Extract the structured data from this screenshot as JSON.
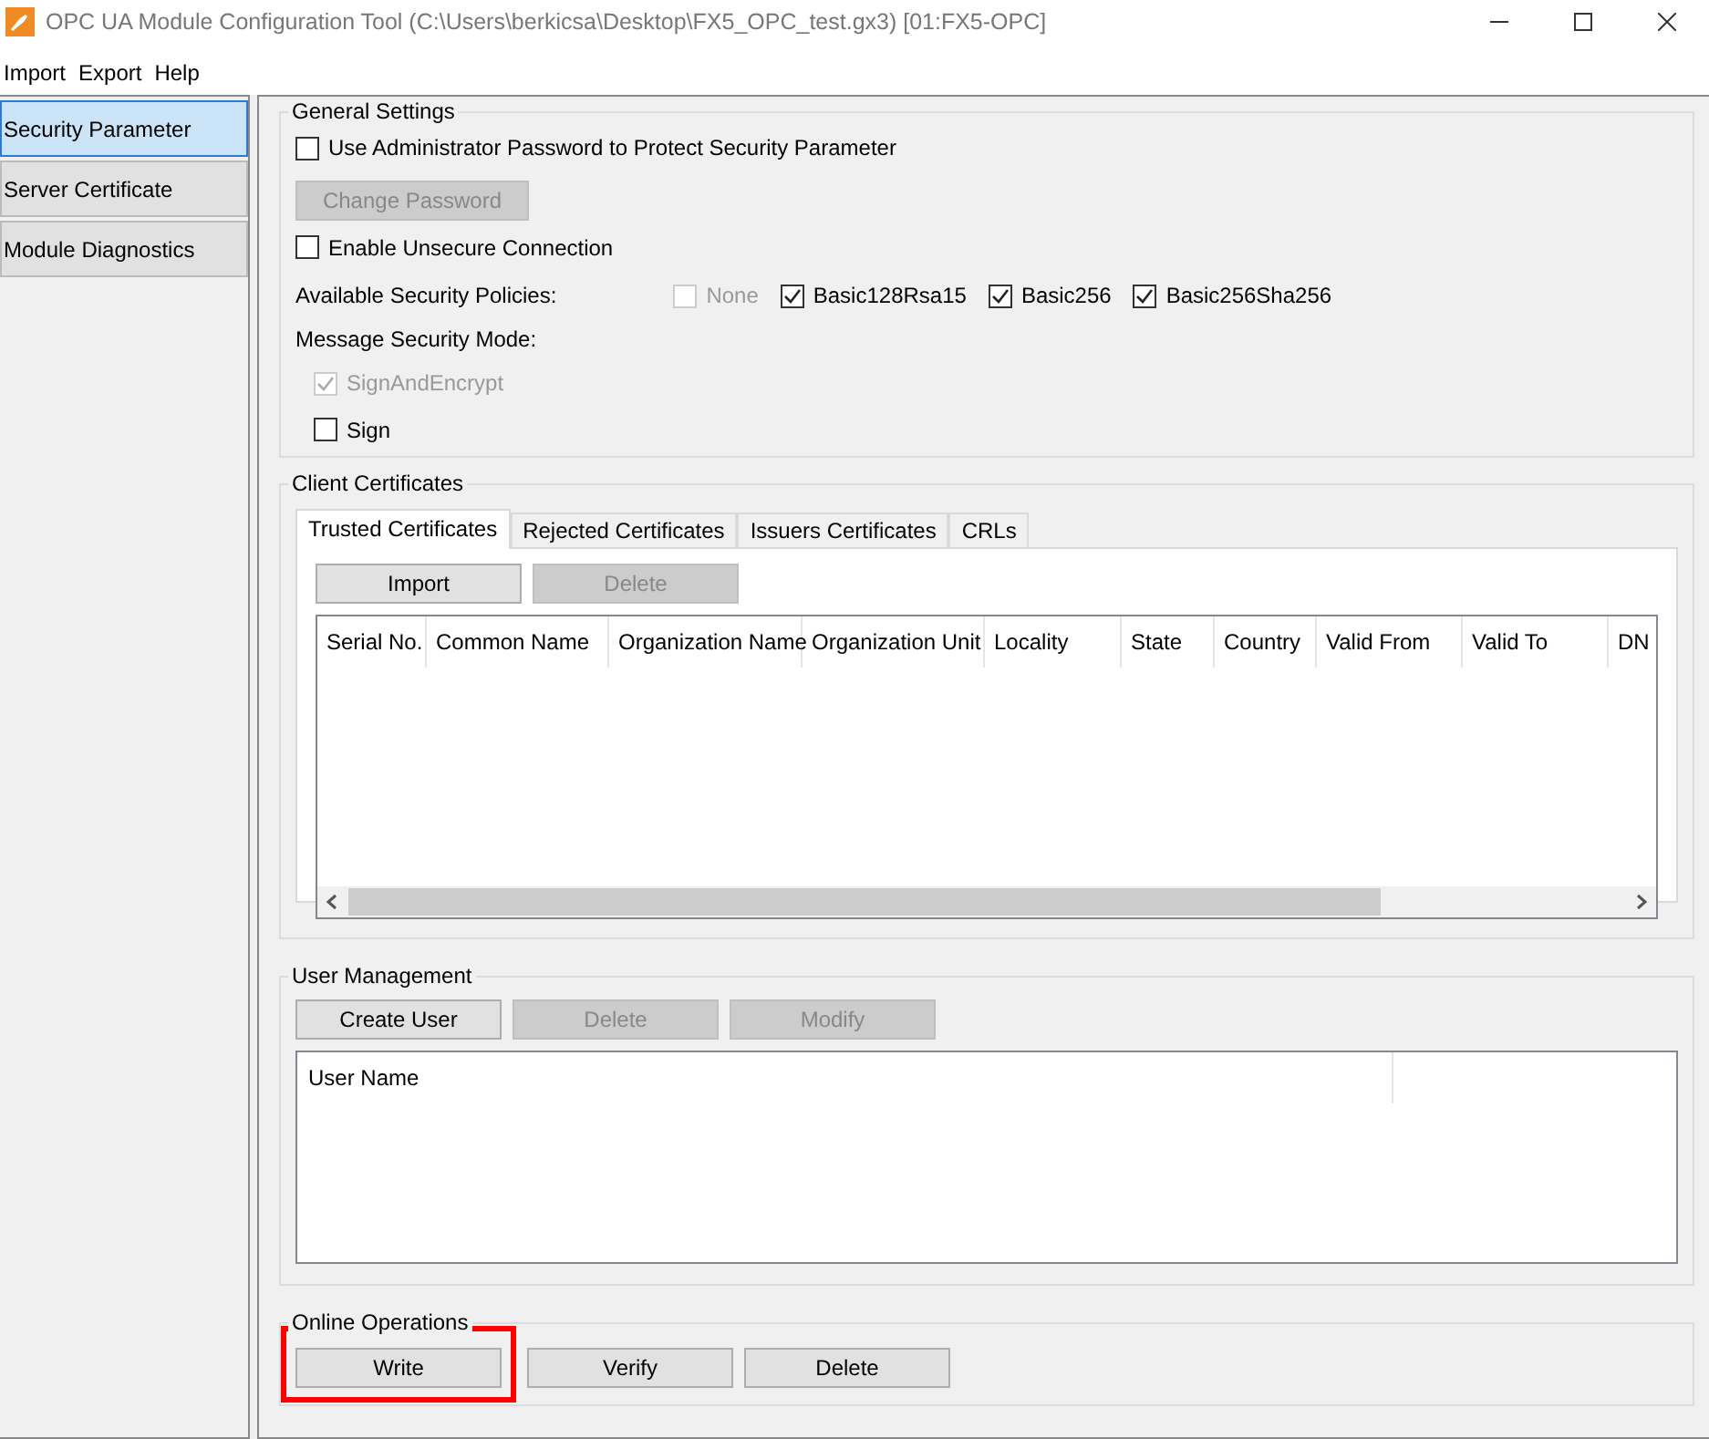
{
  "window": {
    "title": "OPC UA Module Configuration Tool (C:\\Users\\berkicsa\\Desktop\\FX5_OPC_test.gx3) [01:FX5-OPC]"
  },
  "menu": [
    "Import",
    "Export",
    "Help"
  ],
  "sidebar": {
    "items": [
      {
        "label": "Security Parameter",
        "selected": true
      },
      {
        "label": "Server Certificate",
        "selected": false
      },
      {
        "label": "Module Diagnostics",
        "selected": false
      }
    ]
  },
  "general_settings": {
    "title": "General Settings",
    "admin_password": {
      "label": "Use Administrator Password to Protect Security Parameter",
      "checked": false
    },
    "change_password": {
      "label": "Change Password",
      "disabled": true
    },
    "unsecure_connection": {
      "label": "Enable Unsecure Connection",
      "checked": false
    },
    "policies": {
      "label": "Available Security Policies:",
      "options": [
        {
          "label": "None",
          "checked": false,
          "disabled": true
        },
        {
          "label": "Basic128Rsa15",
          "checked": true,
          "disabled": false
        },
        {
          "label": "Basic256",
          "checked": true,
          "disabled": false
        },
        {
          "label": "Basic256Sha256",
          "checked": true,
          "disabled": false
        }
      ]
    },
    "mode": {
      "label": "Message Security Mode:",
      "options": [
        {
          "label": "SignAndEncrypt",
          "checked": true,
          "disabled": true
        },
        {
          "label": "Sign",
          "checked": false,
          "disabled": false
        }
      ]
    }
  },
  "client_certificates": {
    "title": "Client Certificates",
    "tabs": [
      {
        "label": "Trusted Certificates",
        "selected": true
      },
      {
        "label": "Rejected Certificates",
        "selected": false
      },
      {
        "label": "Issuers Certificates",
        "selected": false
      },
      {
        "label": "CRLs",
        "selected": false
      }
    ],
    "buttons": [
      {
        "label": "Import",
        "disabled": false
      },
      {
        "label": "Delete",
        "disabled": true
      }
    ],
    "columns": [
      "Serial No.",
      "Common Name",
      "Organization Name",
      "Organization Unit",
      "Locality",
      "State",
      "Country",
      "Valid From",
      "Valid To",
      "DN"
    ]
  },
  "user_management": {
    "title": "User Management",
    "buttons": [
      {
        "label": "Create User",
        "disabled": false
      },
      {
        "label": "Delete",
        "disabled": true
      },
      {
        "label": "Modify",
        "disabled": true
      }
    ],
    "columns": [
      "User Name"
    ]
  },
  "online_operations": {
    "title": "Online Operations",
    "buttons": [
      {
        "label": "Write",
        "disabled": false,
        "highlighted": true
      },
      {
        "label": "Verify",
        "disabled": false,
        "highlighted": false
      },
      {
        "label": "Delete",
        "disabled": false,
        "highlighted": false
      }
    ]
  }
}
